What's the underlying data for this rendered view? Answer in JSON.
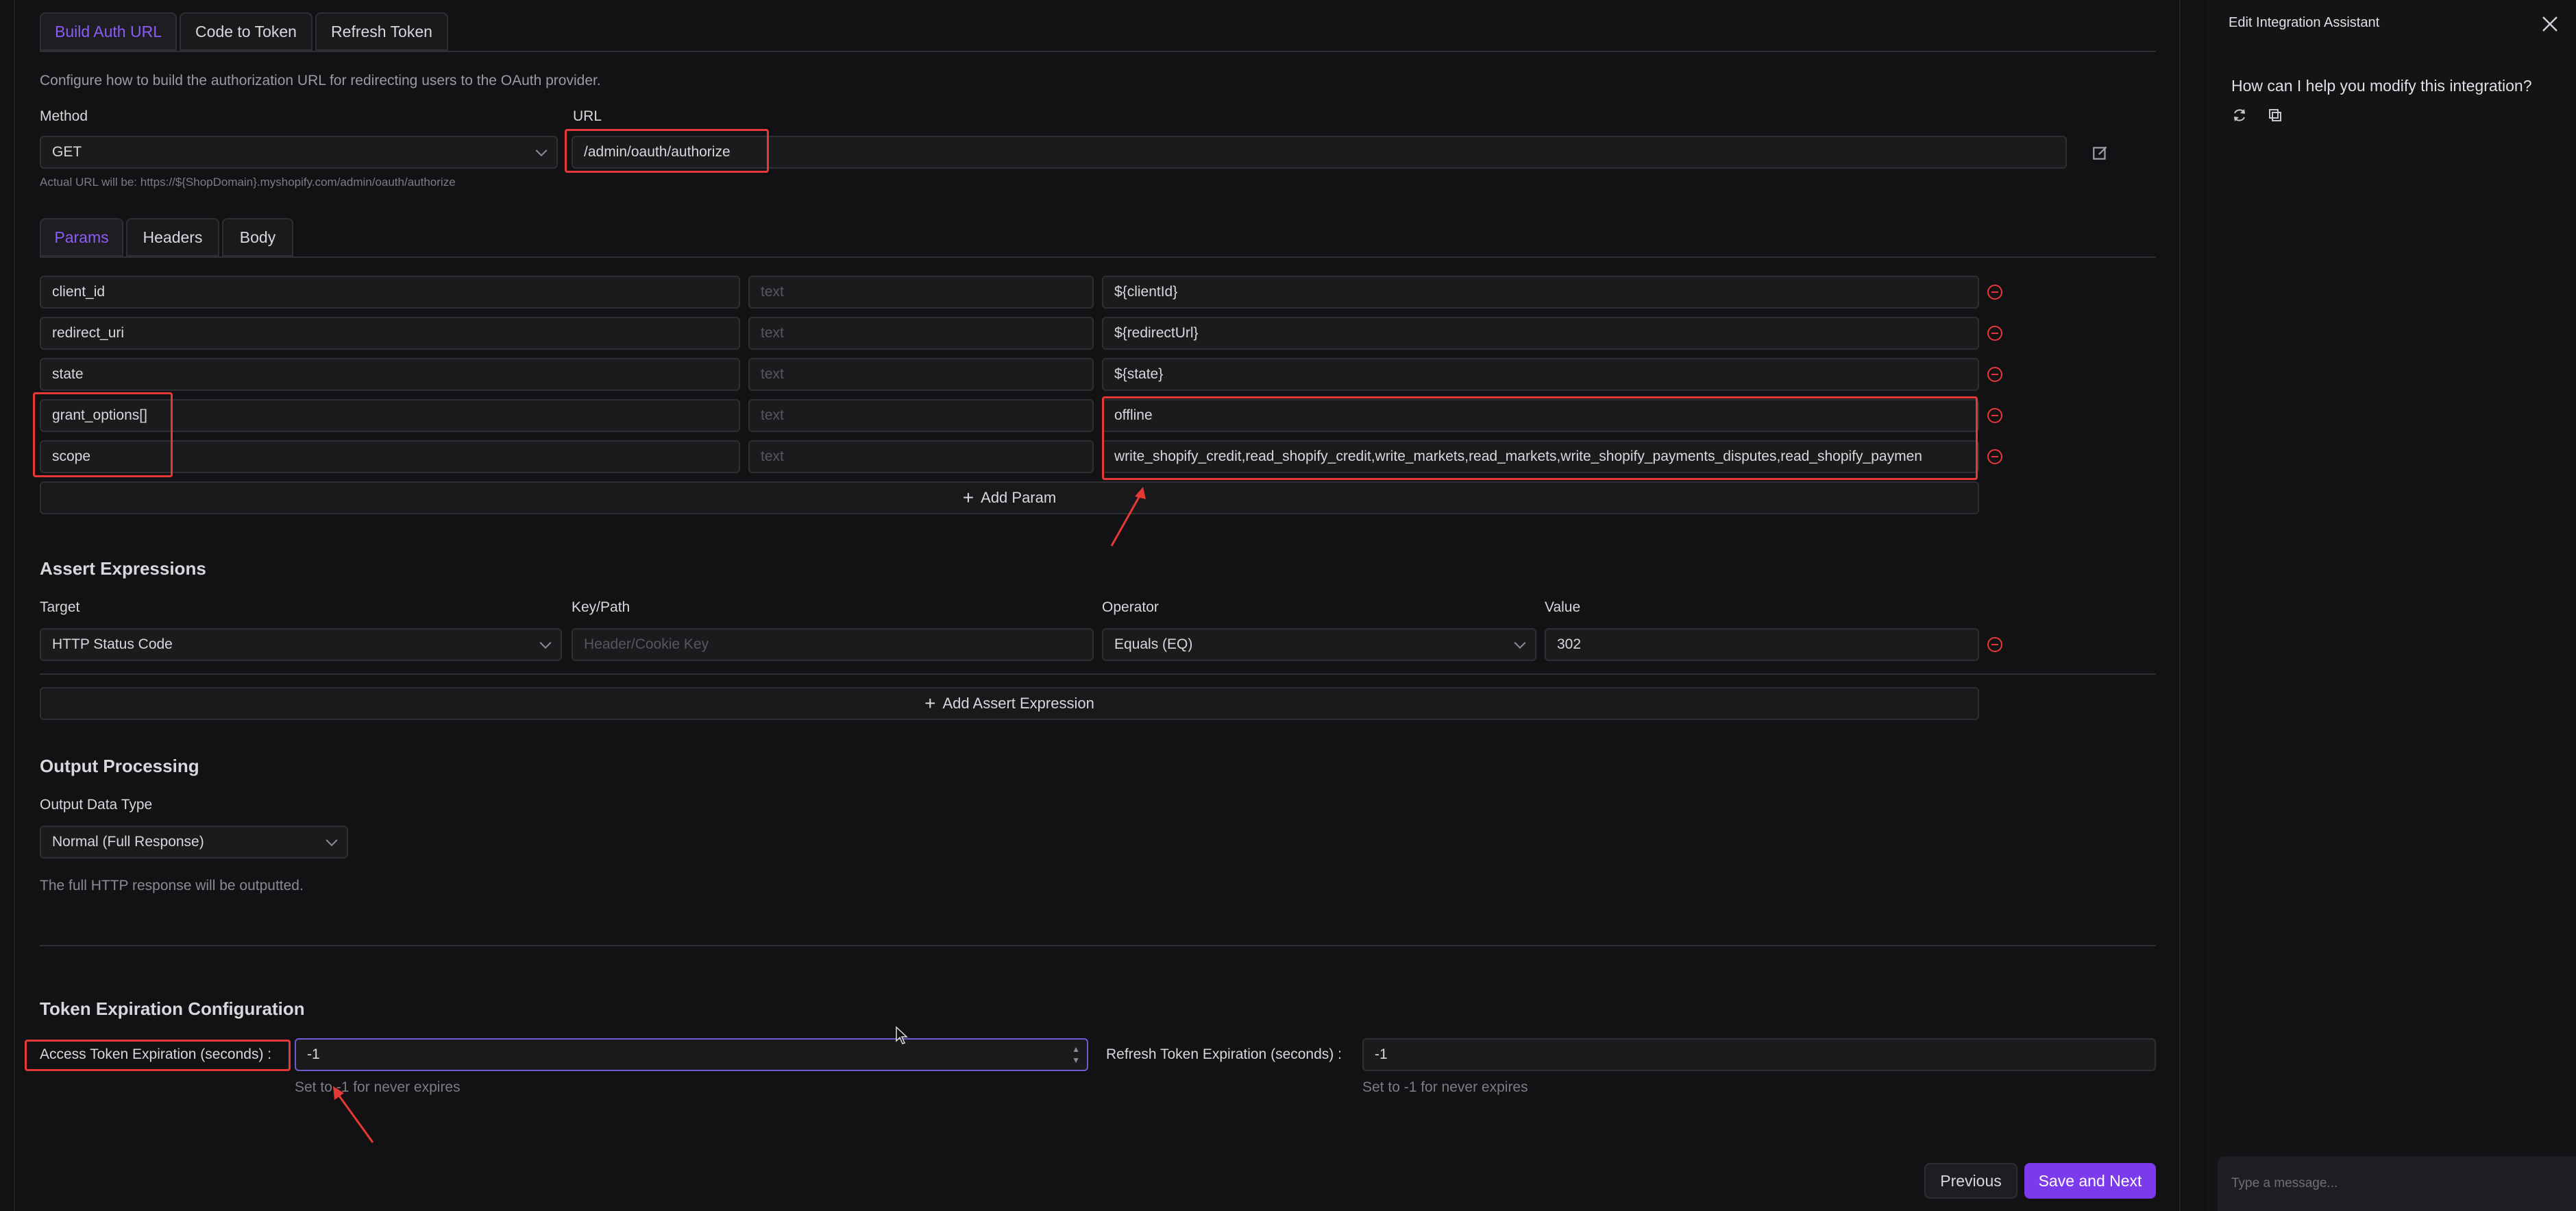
{
  "tabs_top": [
    {
      "label": "Build Auth URL",
      "active": true
    },
    {
      "label": "Code to Token",
      "active": false
    },
    {
      "label": "Refresh Token",
      "active": false
    }
  ],
  "description": "Configure how to build the authorization URL for redirecting users to the OAuth provider.",
  "method": {
    "label": "Method",
    "value": "GET"
  },
  "url": {
    "label": "URL",
    "value": "/admin/oauth/authorize",
    "actual": "Actual URL will be: https://${ShopDomain}.myshopify.com/admin/oauth/authorize"
  },
  "tabs_params": [
    {
      "label": "Params",
      "active": true
    },
    {
      "label": "Headers",
      "active": false
    },
    {
      "label": "Body",
      "active": false
    }
  ],
  "params": [
    {
      "key": "client_id",
      "type_placeholder": "text",
      "value": "${clientId}"
    },
    {
      "key": "redirect_uri",
      "type_placeholder": "text",
      "value": "${redirectUrl}"
    },
    {
      "key": "state",
      "type_placeholder": "text",
      "value": "${state}"
    },
    {
      "key": "grant_options[]",
      "type_placeholder": "text",
      "value": "offline"
    },
    {
      "key": "scope",
      "type_placeholder": "text",
      "value": "write_shopify_credit,read_shopify_credit,write_markets,read_markets,write_shopify_payments_disputes,read_shopify_paymen"
    }
  ],
  "add_param_label": "Add Param",
  "assert": {
    "title": "Assert Expressions",
    "target_label": "Target",
    "keypath_label": "Key/Path",
    "operator_label": "Operator",
    "value_label": "Value",
    "target": "HTTP Status Code",
    "keypath_placeholder": "Header/Cookie Key",
    "operator": "Equals (EQ)",
    "value": "302",
    "add_label": "Add Assert Expression"
  },
  "output": {
    "title": "Output Processing",
    "type_label": "Output Data Type",
    "type_value": "Normal (Full Response)",
    "hint": "The full HTTP response will be outputted."
  },
  "token": {
    "title": "Token Expiration Configuration",
    "access_label": "Access Token Expiration (seconds) :",
    "access_value": "-1",
    "access_hint": "Set to -1 for never expires",
    "refresh_label": "Refresh Token Expiration (seconds) :",
    "refresh_value": "-1",
    "refresh_hint": "Set to -1 for never expires"
  },
  "footer": {
    "previous": "Previous",
    "save_next": "Save and Next"
  },
  "assistant": {
    "title": "Edit Integration Assistant",
    "greeting": "How can I help you modify this integration?",
    "input_placeholder": "Type a message..."
  },
  "colors": {
    "accent": "#8b5cf6",
    "primary_button": "#7c3aed",
    "annotation": "#e53935"
  }
}
